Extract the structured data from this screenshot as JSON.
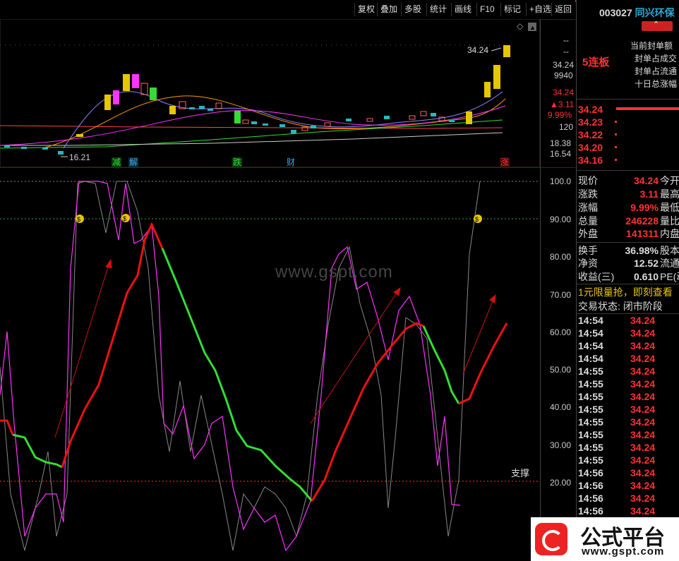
{
  "toolbar": {
    "buttons": [
      "复权",
      "叠加",
      "多股",
      "统计",
      "画线",
      "F10",
      "标记",
      "+自选",
      "返回"
    ]
  },
  "stock": {
    "code": "003027",
    "name": "同兴环保",
    "streak": "5连板",
    "seal_labels": [
      "当前封单额",
      "封单占成交",
      "封单占流通",
      "十日总涨幅"
    ]
  },
  "price_axis": {
    "top_labels": [
      "--",
      "--"
    ],
    "labels": [
      "34.24",
      "9940",
      "34.24",
      "▲3.11",
      "9.99%",
      "120",
      "18.38",
      "16.54"
    ],
    "last_price_tag": "34.24",
    "low_tag": "16.21"
  },
  "events": [
    "减",
    "解",
    "跌",
    "财",
    "涨"
  ],
  "indicator_axis": [
    "100.0",
    "90.00",
    "80.00",
    "70.00",
    "60.00",
    "50.00",
    "40.00",
    "30.00",
    "20.00"
  ],
  "support_label": "支撑",
  "watermark": "www.gspt.com",
  "order_book": [
    {
      "price": "34.24"
    },
    {
      "price": "34.23"
    },
    {
      "price": "34.22"
    },
    {
      "price": "34.20"
    },
    {
      "price": "34.16"
    }
  ],
  "quote": [
    {
      "l": "现价",
      "v": "34.24",
      "r": "今开"
    },
    {
      "l": "涨跌",
      "v": "3.11",
      "r": "最高"
    },
    {
      "l": "涨幅",
      "v": "9.99%",
      "r": "最低"
    },
    {
      "l": "总量",
      "v": "246228",
      "r": "量比"
    },
    {
      "l": "外盘",
      "v": "141311",
      "r": "内盘"
    },
    {
      "l": "换手",
      "v": "36.98%",
      "r": "股本"
    },
    {
      "l": "净资",
      "v": "12.52",
      "r": "流通"
    },
    {
      "l": "收益(三)",
      "v": "0.610",
      "r": "PE(动"
    }
  ],
  "promo": "1元限量抢，即刻查看",
  "trade_status": "交易状态: 闭市阶段",
  "ticks": [
    {
      "t": "14:54",
      "p": "34.24"
    },
    {
      "t": "14:54",
      "p": "34.24"
    },
    {
      "t": "14:54",
      "p": "34.24"
    },
    {
      "t": "14:54",
      "p": "34.24"
    },
    {
      "t": "14:55",
      "p": "34.24"
    },
    {
      "t": "14:55",
      "p": "34.24"
    },
    {
      "t": "14:55",
      "p": "34.24"
    },
    {
      "t": "14:55",
      "p": "34.24"
    },
    {
      "t": "14:55",
      "p": "34.24"
    },
    {
      "t": "14:55",
      "p": "34.24"
    },
    {
      "t": "14:55",
      "p": "34.24"
    },
    {
      "t": "14:55",
      "p": "34.24"
    },
    {
      "t": "14:56",
      "p": "34.24"
    },
    {
      "t": "14:56",
      "p": "34.24"
    },
    {
      "t": "14:56",
      "p": "34.24"
    },
    {
      "t": "14:56",
      "p": "34.24"
    }
  ],
  "logo": {
    "title": "公式平台",
    "url": "www.gspt.com"
  },
  "colors": {
    "up": "#ff3333",
    "down": "#33dd33",
    "accent": "#e6c700",
    "magenta": "#ff33ff"
  }
}
